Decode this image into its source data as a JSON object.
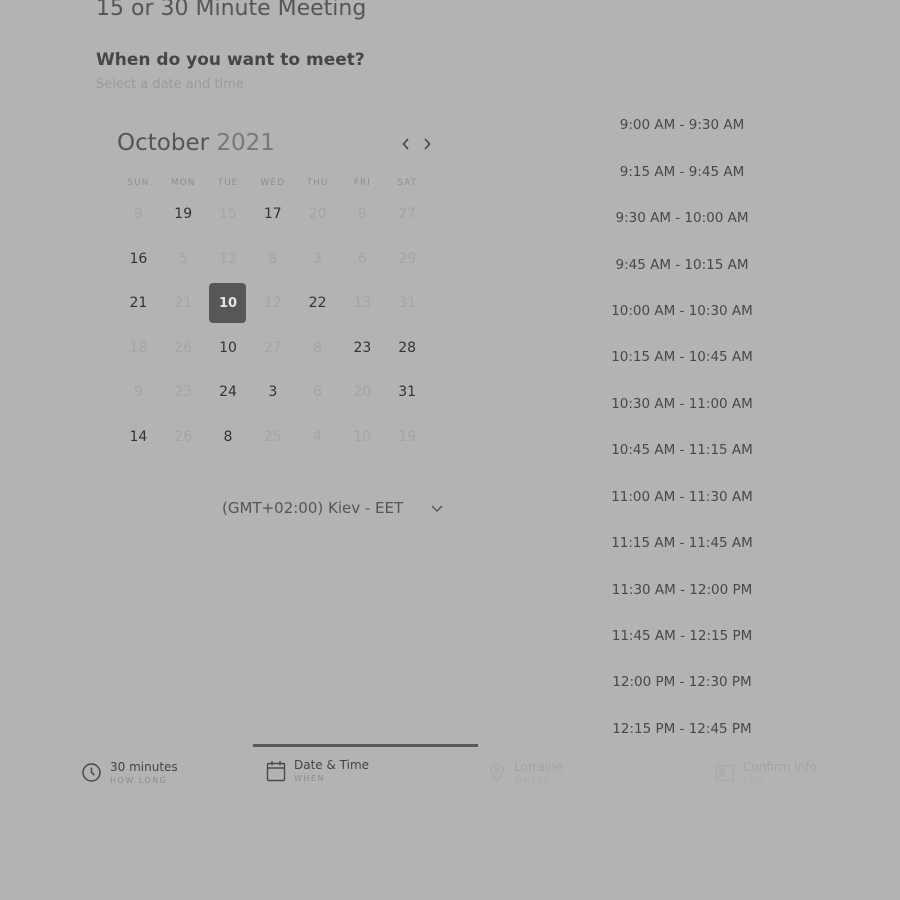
{
  "meeting_title": "15 or 30 Minute Meeting",
  "question": "When do you want to meet?",
  "question_sub": "Select a date and time",
  "calendar": {
    "month": "October",
    "year": "2021",
    "prev_icon": "chevron-left-icon",
    "next_icon": "chevron-right-icon",
    "weekdays": [
      "SUN",
      "MON",
      "TUE",
      "WED",
      "THU",
      "FRI",
      "SAT"
    ],
    "days": [
      {
        "label": "9",
        "available": false
      },
      {
        "label": "19",
        "available": true
      },
      {
        "label": "15",
        "available": false
      },
      {
        "label": "17",
        "available": true
      },
      {
        "label": "20",
        "available": false
      },
      {
        "label": "8",
        "available": false
      },
      {
        "label": "27",
        "available": false
      },
      {
        "label": "16",
        "available": true
      },
      {
        "label": "5",
        "available": false
      },
      {
        "label": "12",
        "available": false
      },
      {
        "label": "8",
        "available": false
      },
      {
        "label": "3",
        "available": false
      },
      {
        "label": "6",
        "available": false
      },
      {
        "label": "29",
        "available": false
      },
      {
        "label": "21",
        "available": true
      },
      {
        "label": "21",
        "available": false
      },
      {
        "label": "10",
        "available": true,
        "selected": true
      },
      {
        "label": "12",
        "available": false
      },
      {
        "label": "22",
        "available": true
      },
      {
        "label": "13",
        "available": false
      },
      {
        "label": "31",
        "available": false
      },
      {
        "label": "18",
        "available": false
      },
      {
        "label": "26",
        "available": false
      },
      {
        "label": "10",
        "available": true
      },
      {
        "label": "27",
        "available": false
      },
      {
        "label": "8",
        "available": false
      },
      {
        "label": "23",
        "available": true
      },
      {
        "label": "28",
        "available": true
      },
      {
        "label": "9",
        "available": false
      },
      {
        "label": "23",
        "available": false
      },
      {
        "label": "24",
        "available": true
      },
      {
        "label": "3",
        "available": true
      },
      {
        "label": "6",
        "available": false
      },
      {
        "label": "20",
        "available": false
      },
      {
        "label": "31",
        "available": true
      },
      {
        "label": "14",
        "available": true
      },
      {
        "label": "26",
        "available": false
      },
      {
        "label": "8",
        "available": true
      },
      {
        "label": "25",
        "available": false
      },
      {
        "label": "4",
        "available": false
      },
      {
        "label": "10",
        "available": false
      },
      {
        "label": "19",
        "available": false
      }
    ]
  },
  "timezone": {
    "label": "(GMT+02:00) Kiev - EET",
    "icon": "chevron-down-icon"
  },
  "time_slots": [
    "9:00 AM - 9:30 AM",
    "9:15 AM - 9:45 AM",
    "9:30 AM - 10:00 AM",
    "9:45 AM - 10:15 AM",
    "10:00 AM - 10:30 AM",
    "10:15 AM - 10:45 AM",
    "10:30 AM - 11:00 AM",
    "10:45 AM - 11:15 AM",
    "11:00 AM - 11:30 AM",
    "11:15 AM - 11:45 AM",
    "11:30 AM - 12:00 PM",
    "11:45 AM - 12:15 PM",
    "12:00 PM - 12:30 PM",
    "12:15 PM - 12:45 PM"
  ],
  "steps": [
    {
      "title": "30 minutes",
      "sub": "HOW LONG",
      "icon": "clock-icon",
      "state": "done"
    },
    {
      "title": "Date & Time",
      "sub": "WHEN",
      "icon": "calendar-icon",
      "state": "active"
    },
    {
      "title": "Lorraine",
      "sub": "WHERE",
      "icon": "location-icon",
      "state": "pending"
    },
    {
      "title": "Confirm Info",
      "sub": "YOU",
      "icon": "user-card-icon",
      "state": "pending"
    }
  ]
}
